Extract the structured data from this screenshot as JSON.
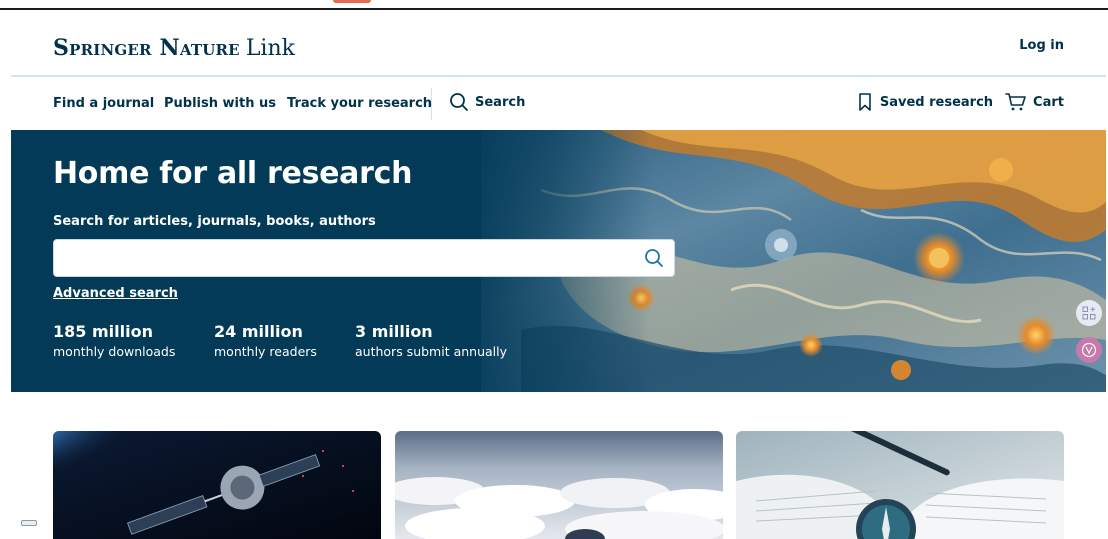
{
  "header": {
    "logo_brand": "Springer Nature",
    "logo_link": "Link",
    "login_label": "Log in"
  },
  "nav": {
    "items": [
      "Find a journal",
      "Publish with us",
      "Track your research"
    ],
    "search_label": "Search",
    "saved_label": "Saved research",
    "cart_label": "Cart"
  },
  "hero": {
    "title": "Home for all research",
    "search_label": "Search for articles, journals, books, authors",
    "search_value": "",
    "advanced_label": "Advanced search",
    "stats": [
      {
        "value": "185 million",
        "label": "monthly downloads"
      },
      {
        "value": "24 million",
        "label": "monthly readers"
      },
      {
        "value": "3 million",
        "label": "authors submit annually"
      }
    ]
  },
  "icons": {
    "search": "search-icon",
    "bookmark": "bookmark-icon",
    "cart": "cart-icon"
  },
  "colors": {
    "brand_navy": "#01324b",
    "hero_bg": "#023a57",
    "accent_blue": "#1b73a8"
  }
}
